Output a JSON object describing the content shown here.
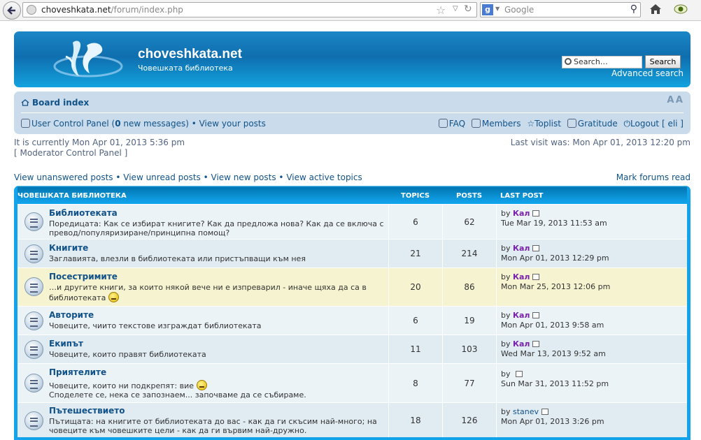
{
  "browser": {
    "url_host": "choveshkata.net",
    "url_path": "/forum/index.php",
    "search_engine_placeholder": "Google"
  },
  "header": {
    "site_title": "choveshkata.net",
    "site_description": "Човешката библиотека",
    "search_placeholder": "Search…",
    "search_button": "Search",
    "advanced_search": "Advanced search"
  },
  "navbar": {
    "board_index": "Board index",
    "font_size_control": "A A",
    "ucp": "User Control Panel",
    "ucp_count_open": " (",
    "new_messages_count": "0",
    "ucp_count_close": " new messages)",
    "sep1": " • ",
    "view_posts": "View your posts",
    "faq": "FAQ",
    "members": "Members",
    "toplist": "Toplist",
    "gratitude": "Gratitude",
    "logout": "Logout [ eli ]"
  },
  "info": {
    "current_time": "It is currently Mon Apr 01, 2013 5:36 pm",
    "mcp": "[ Moderator Control Panel ]",
    "last_visit": "Last visit was: Mon Apr 01, 2013 12:20 pm"
  },
  "search_links": {
    "unanswered": "View unanswered posts",
    "unread": "View unread posts",
    "new_posts": "View new posts",
    "active": "View active topics",
    "sep": " • ",
    "mark_read": "Mark forums read"
  },
  "forum_table": {
    "category": "ЧОВЕШКАТА БИБЛИОТЕКА",
    "col_topics": "TOPICS",
    "col_posts": "POSTS",
    "col_last_post": "LAST POST",
    "by_label": "by",
    "rows": [
      {
        "title": "Библиотеката",
        "desc": "Поредицата: Как се избират книгите? Как да предложа нова? Как да се включа с превод/популяризиране/принципна помощ?",
        "topics": "6",
        "posts": "62",
        "author": "Кал",
        "date": "Tue Mar 19, 2013 11:53 am"
      },
      {
        "title": "Книгите",
        "desc": "Заглавията, влезли в библиотеката или пристъпващи към нея",
        "topics": "21",
        "posts": "214",
        "author": "Кал",
        "date": "Mon Apr 01, 2013 12:29 pm"
      },
      {
        "title": "Посестримите",
        "desc": "…и другите книги, за които някой вече ни е изпреварил - иначе щяха да са в библиотеката",
        "topics": "20",
        "posts": "86",
        "author": "Кал",
        "date": "Mon Mar 25, 2013 12:06 pm"
      },
      {
        "title": "Авторите",
        "desc": "Човеците, чиито текстове изграждат библиотеката",
        "topics": "6",
        "posts": "19",
        "author": "Кал",
        "date": "Mon Apr 01, 2013 9:58 am"
      },
      {
        "title": "Екипът",
        "desc": "Човеците, които правят библиотеката",
        "topics": "11",
        "posts": "103",
        "author": "Кал",
        "date": "Wed Mar 13, 2013 9:52 am"
      },
      {
        "title": "Приятелите",
        "desc": "Човеците, които ни подкрепят: вие",
        "desc2": "Споделете се, нека се запознаем... започваме да се събираме.",
        "topics": "8",
        "posts": "77",
        "author": "",
        "date": "Sun Mar 31, 2013 11:52 pm"
      },
      {
        "title": "Пътешествието",
        "desc": "Пътищата: на книгите от библиотеката до вас - как да ги скъсим най-много; на човеците към човешките цели - как да ги вървим най-дружно.",
        "topics": "18",
        "posts": "126",
        "author": "stanev",
        "date": "Mon Apr 01, 2013 3:26 pm"
      }
    ]
  }
}
